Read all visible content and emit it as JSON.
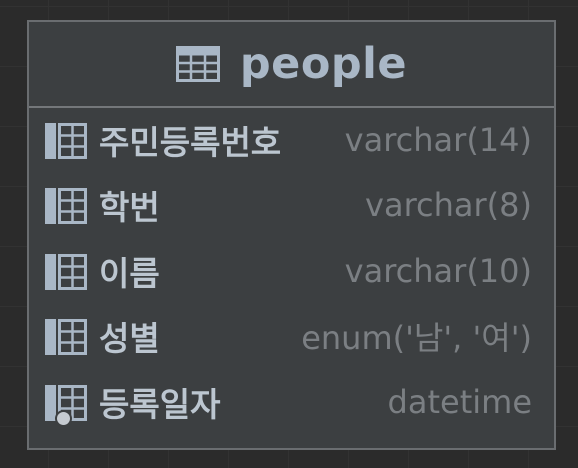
{
  "table": {
    "name": "people",
    "icon": "table-icon",
    "columns": [
      {
        "name": "주민등록번호",
        "type": "varchar(14)",
        "icon": "column-icon",
        "marker": null
      },
      {
        "name": "학번",
        "type": "varchar(8)",
        "icon": "column-icon",
        "marker": null
      },
      {
        "name": "이름",
        "type": "varchar(10)",
        "icon": "column-icon",
        "marker": null
      },
      {
        "name": "성별",
        "type": "enum('남', '여')",
        "icon": "column-icon",
        "marker": null
      },
      {
        "name": "등록일자",
        "type": "datetime",
        "icon": "column-icon",
        "marker": "nullable-dot-icon"
      }
    ]
  },
  "colors": {
    "background": "#2b2b2b",
    "card": "#3c3f41",
    "border": "#6a6d70",
    "title": "#a9b7c6",
    "column_name": "#bcc6d0",
    "column_type": "#7b7f83"
  }
}
